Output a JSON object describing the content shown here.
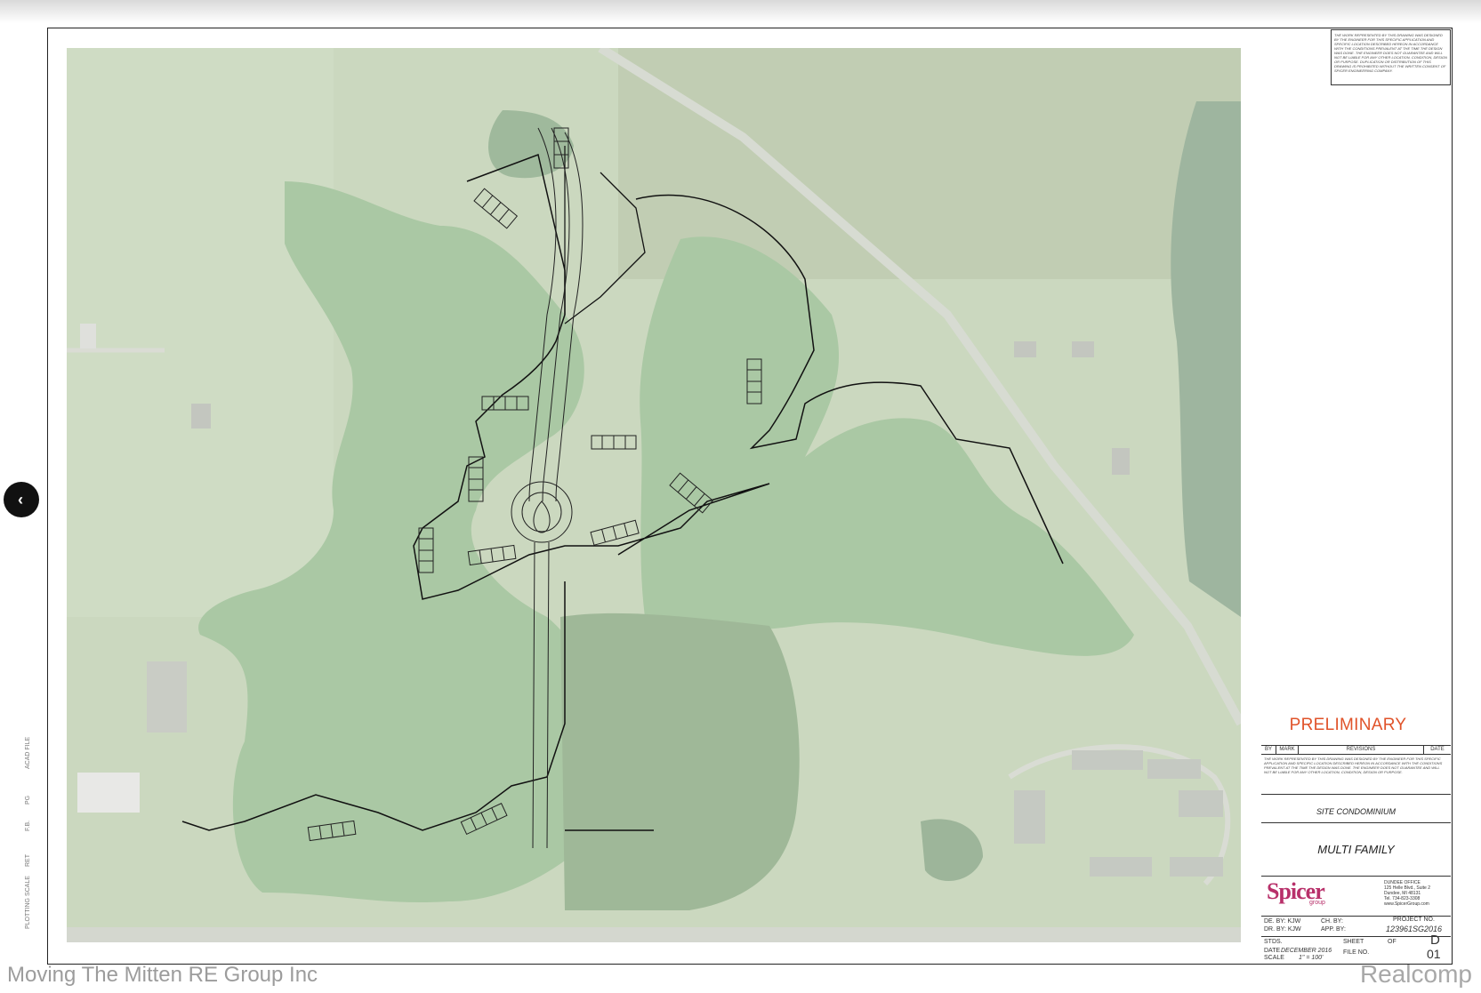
{
  "drawing": {
    "notice": "THE WORK REPRESENTED BY THIS DRAWING WAS DESIGNED BY THE ENGINEER FOR THIS SPECIFIC APPLICATION AND SPECIFIC LOCATION DESCRIBED HEREON IN ACCORDANCE WITH THE CONDITIONS PREVALENT AT THE TIME THE DESIGN WAS DONE. THE ENGINEER DOES NOT GUARANTEE AND WILL NOT BE LIABLE FOR ANY OTHER LOCATION, CONDITION, DESIGN OR PURPOSE. DUPLICATION OR DISTRIBUTION OF THIS DRAWING IS PROHIBITED WITHOUT THE WRITTEN CONSENT OF SPICER ENGINEERING COMPANY.",
    "side_labels": [
      "PLOTTING SCALE",
      "RET",
      "F.B.",
      "PG",
      "ACAD FILE"
    ],
    "status": "PRELIMINARY",
    "revisions_header": {
      "by": "BY",
      "mark": "MARK",
      "revisions": "REVISIONS",
      "date": "DATE"
    },
    "revision_notice": "THE WORK REPRESENTED BY THIS DRAWING WAS DESIGNED BY THE ENGINEER FOR THIS SPECIFIC APPLICATION AND SPECIFIC LOCATION DESCRIBED HEREON IN ACCORDANCE WITH THE CONDITIONS PREVALENT AT THE TIME THE DESIGN WAS DONE. THE ENGINEER DOES NOT GUARANTEE AND WILL NOT BE LIABLE FOR ANY OTHER LOCATION, CONDITION, DESIGN OR PURPOSE.",
    "project_type": "SITE CONDOMINIUM",
    "sheet_title": "MULTI FAMILY",
    "company_logo": {
      "word": "Spicer",
      "sub": "group"
    },
    "office": {
      "name": "DUNDEE OFFICE",
      "address1": "125 Helle Blvd., Suite 2",
      "address2": "Dundee, MI 48131",
      "phone": "Tel. 734-823-3308",
      "web": "www.SpicerGroup.com"
    },
    "fields": {
      "de_by": "DE. BY: KJW",
      "dr_by": "DR. BY: KJW",
      "ch_by": "CH. BY:",
      "app_by": "APP. BY:",
      "project_no_label": "PROJECT NO.",
      "project_no": "123961SG2016",
      "stds": "STDS.",
      "date": "DATE",
      "date_value": "DECEMBER 2016",
      "scale": "SCALE",
      "scale_value": "1\" = 100'",
      "sheet_label": "SHEET",
      "of_label": "OF",
      "file_no": "FILE NO.",
      "sheet_letter": "D",
      "sheet_number": "01"
    }
  },
  "nav": {
    "prev_symbol": "‹"
  },
  "watermarks": {
    "left": "Moving The Mitten RE Group Inc",
    "right": "Realcomp"
  },
  "colors": {
    "aerial_base": "#c9d8bd",
    "wetland": "#a9c7a3",
    "lake": "#9ab59a",
    "preliminary": "#e0532a",
    "logo": "#b8306a"
  }
}
